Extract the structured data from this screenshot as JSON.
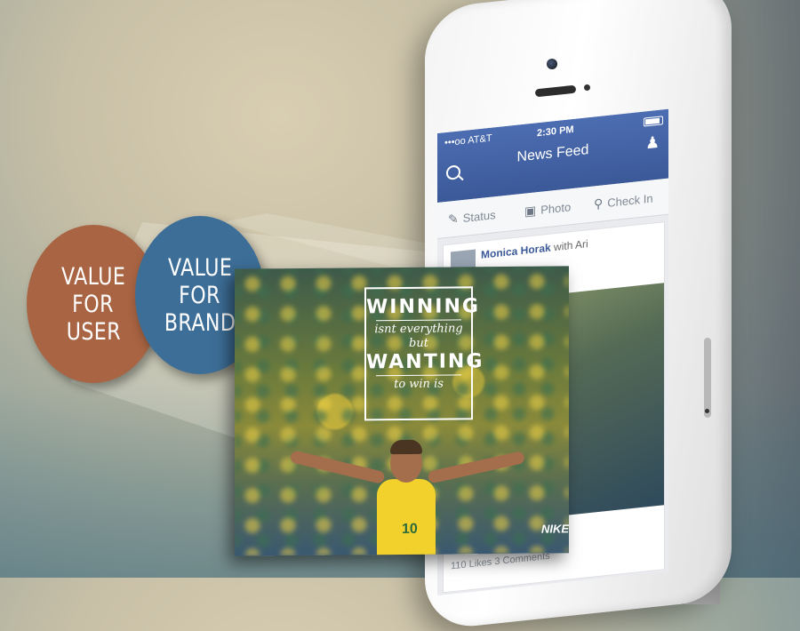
{
  "bubbles": {
    "user": [
      "VALUE",
      "FOR",
      "USER"
    ],
    "brand": [
      "VALUE",
      "FOR",
      "BRAND"
    ]
  },
  "quote": {
    "line1": "WINNING",
    "line2": "isnt everything",
    "line3": "but",
    "line4": "WANTING",
    "line5": "to win is"
  },
  "brand_logo": "NIKE",
  "jersey_number": "10",
  "phone": {
    "carrier": "•••oo AT&T",
    "time": "2:30 PM",
    "title": "News Feed",
    "actions": {
      "status": "Status",
      "photo": "Photo",
      "checkin": "Check In"
    },
    "post": {
      "author": "Monica Horak",
      "with_text": "with Ari",
      "likes": "110 Likes 3 Comments"
    }
  },
  "colors": {
    "user_bubble": "#a86443",
    "brand_bubble": "#3d6e97",
    "facebook_blue": "#3b5998"
  }
}
